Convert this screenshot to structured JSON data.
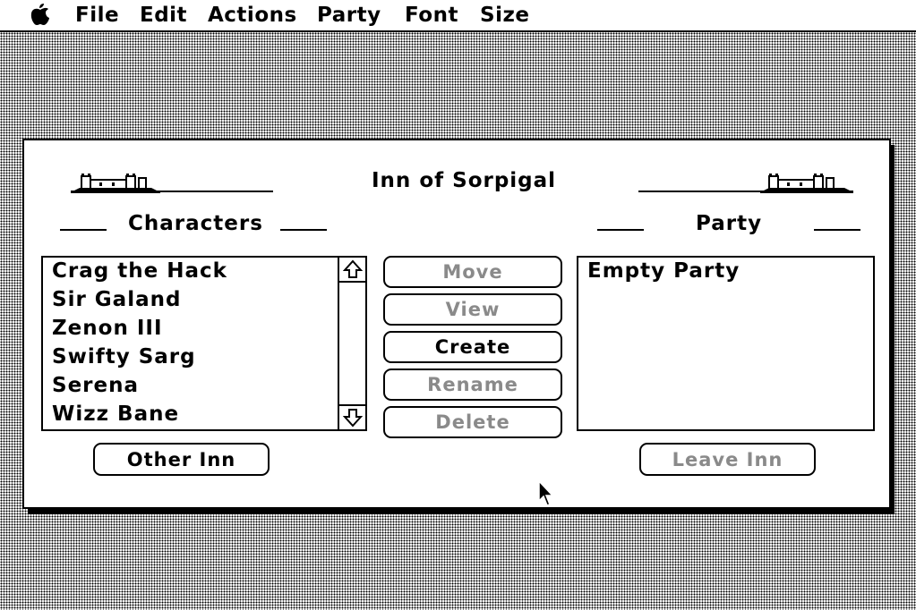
{
  "menubar": {
    "apple_icon": "apple-logo",
    "items": [
      "File",
      "Edit",
      "Actions",
      "Party",
      "Font",
      "Size"
    ]
  },
  "window": {
    "title": "Inn of Sorpigal",
    "characters_heading": "Characters",
    "party_heading": "Party",
    "characters": [
      "Crag the Hack",
      "Sir Galand",
      "Zenon III",
      "Swifty Sarg",
      "Serena",
      "Wizz Bane"
    ],
    "party_list": [
      "Empty Party"
    ],
    "buttons": {
      "move": "Move",
      "view": "View",
      "create": "Create",
      "rename": "Rename",
      "delete": "Delete",
      "other_inn": "Other Inn",
      "leave_inn": "Leave Inn"
    },
    "button_states": {
      "move": "disabled",
      "view": "disabled",
      "create": "enabled",
      "rename": "disabled",
      "delete": "disabled",
      "other_inn": "enabled",
      "leave_inn": "disabled"
    }
  },
  "colors": {
    "foreground": "#000000",
    "background": "#ffffff",
    "disabled_text": "#8a8a8a"
  }
}
